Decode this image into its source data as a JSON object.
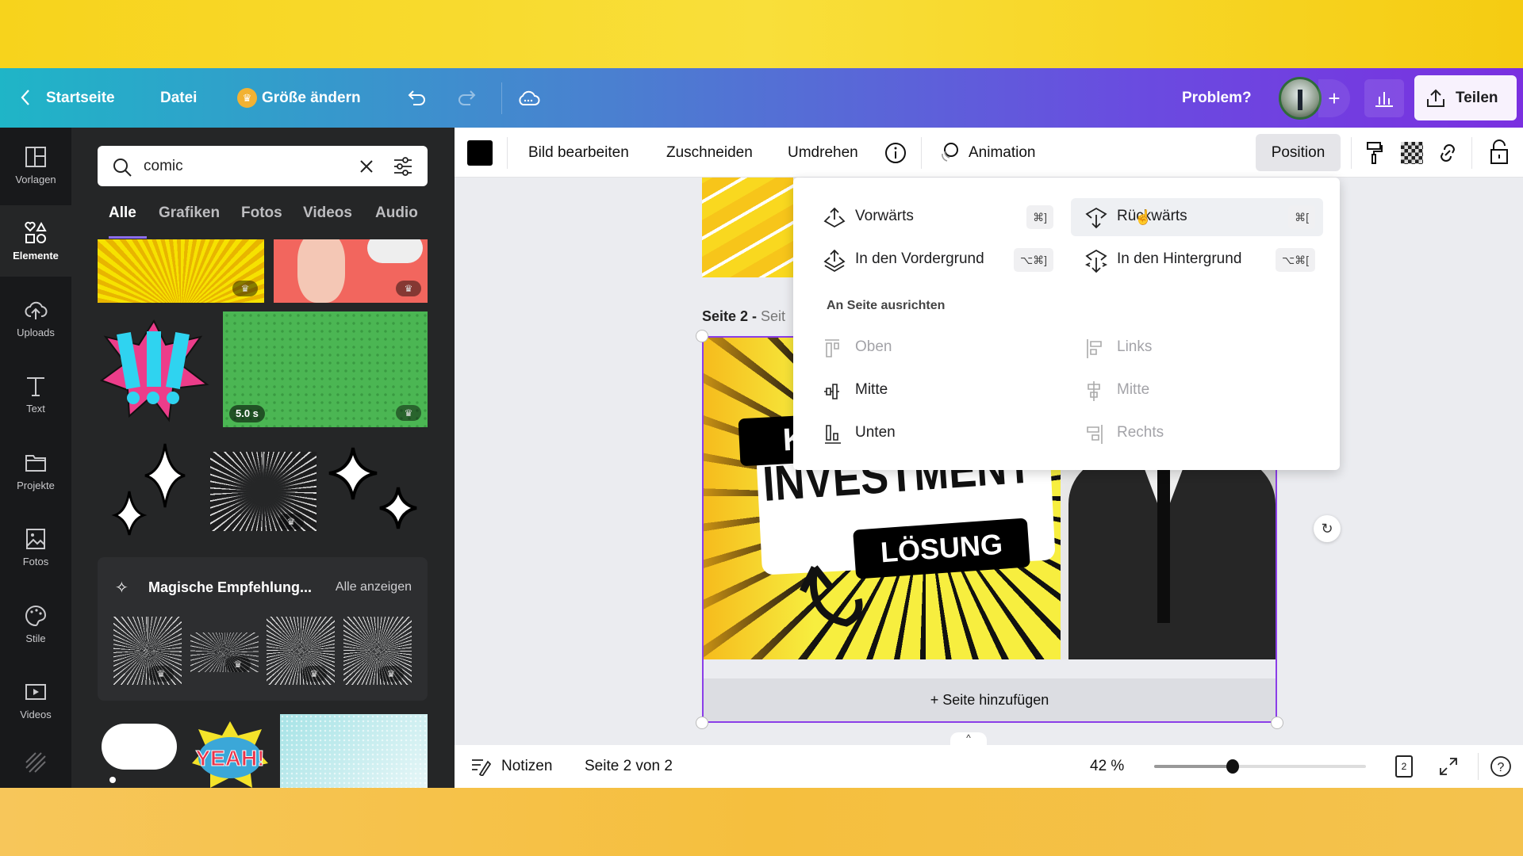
{
  "topbar": {
    "back": "Startseite",
    "file": "Datei",
    "resize": "Größe ändern",
    "problem": "Problem?",
    "share": "Teilen"
  },
  "toolbar": {
    "edit_image": "Bild bearbeiten",
    "crop": "Zuschneiden",
    "flip": "Umdrehen",
    "animation": "Animation",
    "position": "Position",
    "color": "#000000"
  },
  "rail": [
    {
      "label": "Vorlagen"
    },
    {
      "label": "Elemente"
    },
    {
      "label": "Uploads"
    },
    {
      "label": "Text"
    },
    {
      "label": "Projekte"
    },
    {
      "label": "Fotos"
    },
    {
      "label": "Stile"
    },
    {
      "label": "Videos"
    }
  ],
  "panel": {
    "search_value": "comic",
    "tabs": [
      "Alle",
      "Grafiken",
      "Fotos",
      "Videos",
      "Audio"
    ],
    "active_tab": "Alle",
    "video_duration": "5.0 s",
    "magic_title": "Magische Empfehlung...",
    "see_all": "Alle anzeigen",
    "sticker_text": "YEAH!"
  },
  "canvas": {
    "page_label": "Seite 2 - ",
    "page_label_rest": "Seit",
    "design_text": {
      "k": "K",
      "investment": "INVESTMENT",
      "solution": "LÖSUNG"
    },
    "add_page": "+ Seite hinzufügen"
  },
  "position_menu": {
    "forward": {
      "label": "Vorwärts",
      "shortcut": "⌘]"
    },
    "backward": {
      "label": "Rückwärts",
      "shortcut": "⌘["
    },
    "to_front": {
      "label": "In den Vordergrund",
      "shortcut": "⌥⌘]"
    },
    "to_back": {
      "label": "In den Hintergrund",
      "shortcut": "⌥⌘["
    },
    "align_header": "An Seite ausrichten",
    "align": {
      "top": "Oben",
      "middle_v": "Mitte",
      "bottom": "Unten",
      "left": "Links",
      "middle_h": "Mitte",
      "right": "Rechts"
    }
  },
  "bottombar": {
    "notes": "Notizen",
    "page": "Seite 2 von 2",
    "zoom": "42 %",
    "zoom_value": 42,
    "page_count": "2"
  },
  "colors": {
    "accent": "#7d2ae8",
    "panel": "#252627"
  }
}
